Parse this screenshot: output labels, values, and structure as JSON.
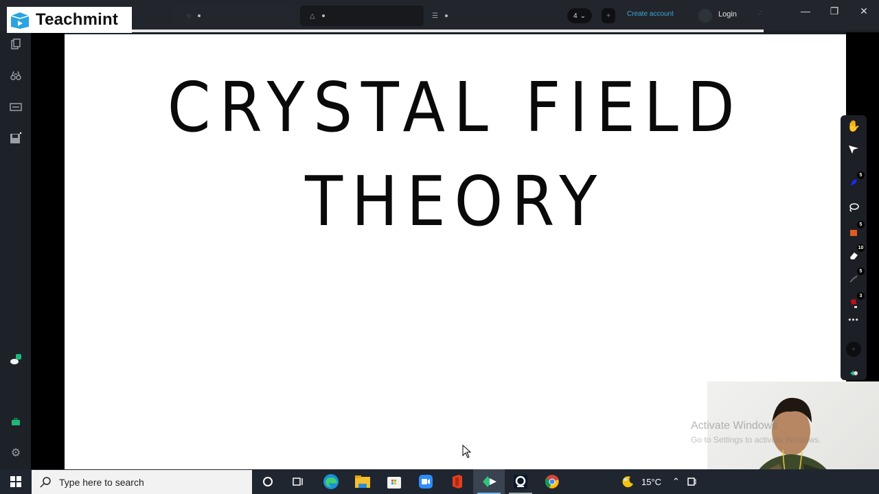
{
  "app": {
    "brand": "Teachmint",
    "brand_color": "#2aa3e0",
    "topbar": {
      "page_selector": "4",
      "create_account": "Create account",
      "login": "Login"
    },
    "window_controls": [
      "minimize",
      "restore",
      "close"
    ]
  },
  "sidebar": {
    "items": [
      {
        "icon": "copy-pages-icon"
      },
      {
        "icon": "binoculars-icon"
      },
      {
        "icon": "slide-rectangle-icon"
      },
      {
        "icon": "save-icon"
      },
      {
        "icon": "cloud-sync-icon"
      },
      {
        "icon": "briefcase-icon"
      },
      {
        "icon": "settings-gear-icon"
      }
    ]
  },
  "board": {
    "title_line1": "CRYSTAL  FIELD",
    "title_line2": "THEORY"
  },
  "tools": {
    "items": [
      {
        "icon": "hand-pan-icon",
        "badge": ""
      },
      {
        "icon": "pointer-icon",
        "badge": ""
      },
      {
        "icon": "pen-blue-icon",
        "badge": "5",
        "color": "#1a2bff"
      },
      {
        "icon": "lasso-icon",
        "badge": ""
      },
      {
        "icon": "highlighter-orange-icon",
        "badge": "5",
        "color": "#e35a22"
      },
      {
        "icon": "eraser-icon",
        "badge": "10"
      },
      {
        "icon": "shapes-icon",
        "badge": "5"
      },
      {
        "icon": "fill-red-icon",
        "badge": "3",
        "color": "#c0101c"
      },
      {
        "icon": "more-icon",
        "badge": ""
      },
      {
        "icon": "zoom-dial-icon",
        "badge": ""
      },
      {
        "icon": "pen-green-icon",
        "badge": "",
        "color": "#1fc27a"
      }
    ]
  },
  "watermark": {
    "line1": "Activate Windows",
    "line2": "Go to Settings to activate Windows."
  },
  "taskbar": {
    "search_placeholder": "Type here to search",
    "apps": [
      "cortana",
      "task-view",
      "edge",
      "file-explorer",
      "microsoft-store",
      "zoom",
      "office",
      "whiteboard-app",
      "webcam-app",
      "chrome"
    ],
    "weather": "15°C"
  }
}
